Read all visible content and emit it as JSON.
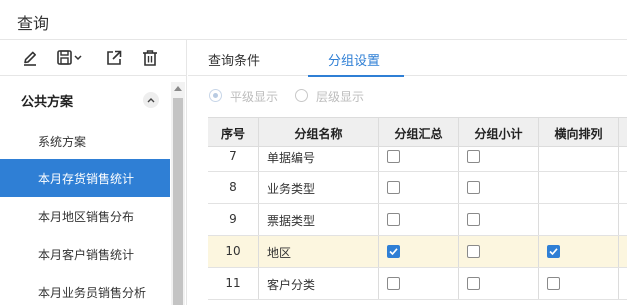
{
  "window": {
    "title": "查询"
  },
  "toolbar": {
    "buttons": [
      {
        "icon": "edit-icon"
      },
      {
        "icon": "save-icon"
      },
      {
        "icon": "export-icon"
      },
      {
        "icon": "delete-icon"
      }
    ]
  },
  "sidebar": {
    "section_title": "公共方案",
    "items": [
      {
        "label": "系统方案",
        "active": false
      },
      {
        "label": "本月存货销售统计",
        "active": true
      },
      {
        "label": "本月地区销售分布",
        "active": false
      },
      {
        "label": "本月客户销售统计",
        "active": false
      },
      {
        "label": "本月业务员销售分析",
        "active": false
      }
    ]
  },
  "tabs": [
    {
      "label": "查询条件",
      "active": false
    },
    {
      "label": "分组设置",
      "active": true
    }
  ],
  "display_mode": {
    "options": [
      {
        "label": "平级显示",
        "checked": true
      },
      {
        "label": "层级显示",
        "checked": false
      }
    ]
  },
  "grid": {
    "columns": [
      "序号",
      "分组名称",
      "分组汇总",
      "分组小计",
      "横向排列"
    ],
    "rows": [
      {
        "no": "7",
        "name": "单据编号",
        "sum": false,
        "sub": false,
        "cross": null,
        "selected": false
      },
      {
        "no": "8",
        "name": "业务类型",
        "sum": false,
        "sub": false,
        "cross": null,
        "selected": false
      },
      {
        "no": "9",
        "name": "票据类型",
        "sum": false,
        "sub": false,
        "cross": null,
        "selected": false
      },
      {
        "no": "10",
        "name": "地区",
        "sum": true,
        "sub": false,
        "cross": true,
        "selected": true
      },
      {
        "no": "11",
        "name": "客户分类",
        "sum": false,
        "sub": false,
        "cross": false,
        "selected": false
      }
    ]
  },
  "colors": {
    "accent": "#2f7fd5",
    "selected_row": "#fcf6df",
    "header_bg": "#efefef"
  }
}
